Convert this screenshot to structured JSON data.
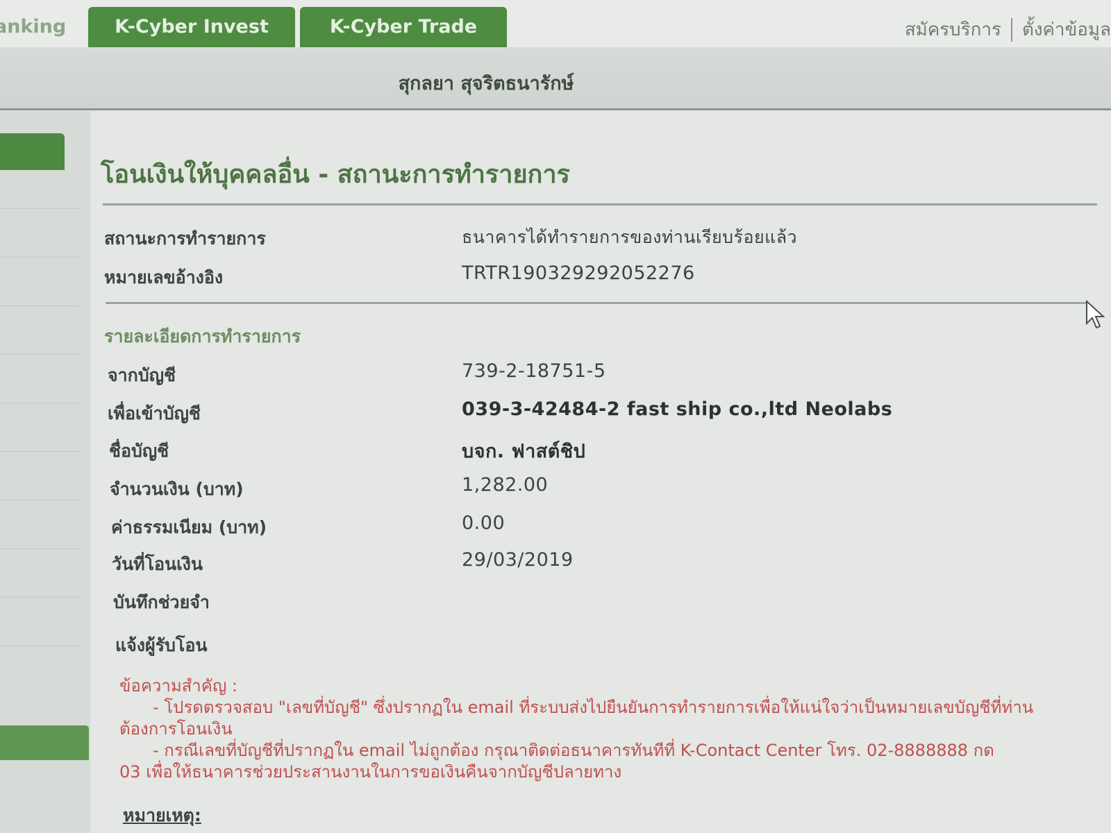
{
  "nav": {
    "partial_tab": "anking",
    "tabs": [
      {
        "label": "K-Cyber Invest"
      },
      {
        "label": "K-Cyber Trade"
      }
    ],
    "links": {
      "register": "สมัครบริการ",
      "settings": "ตั้งค่าข้อมูล"
    }
  },
  "user": {
    "name": "สุกลยา สุจริตธนารักษ์"
  },
  "page": {
    "title": "โอนเงินให้บุคคลอื่น - สถานะการทำรายการ"
  },
  "status": {
    "status_label": "สถานะการทำรายการ",
    "status_value": "ธนาคารได้ทำรายการของท่านเรียบร้อยแล้ว",
    "ref_label": "หมายเลขอ้างอิง",
    "ref_value": "TRTR190329292052276"
  },
  "details": {
    "heading": "รายละเอียดการทำรายการ",
    "from_label": "จากบัญชี",
    "from_value": "739-2-18751-5",
    "to_label": "เพื่อเข้าบัญชี",
    "to_value": "039-3-42484-2 fast ship co.,ltd Neolabs",
    "name_label": "ชื่อบัญชี",
    "name_value": "บจก. ฟาสต์ชิป",
    "amount_label": "จำนวนเงิน (บาท)",
    "amount_value": "1,282.00",
    "fee_label": "ค่าธรรมเนียม (บาท)",
    "fee_value": "0.00",
    "date_label": "วันที่โอนเงิน",
    "date_value": "29/03/2019",
    "memo_label": "บันทึกช่วยจำ",
    "notify_label": "แจ้งผู้รับโอน"
  },
  "notice": {
    "title": "ข้อความสำคัญ :",
    "line1": "- โปรดตรวจสอบ \"เลขที่บัญชี\" ซึ่งปรากฏใน email ที่ระบบส่งไปยืนยันการทำรายการเพื่อให้แน่ใจว่าเป็นหมายเลขบัญชีที่ท่าน",
    "line1b": "ต้องการโอนเงิน",
    "line2": "- กรณีเลขที่บัญชีที่ปรากฏใน email ไม่ถูกต้อง กรุณาติดต่อธนาคารทันทีที่ K-Contact Center โทร. 02-8888888 กด",
    "line2b": "03 เพื่อให้ธนาคารช่วยประสานงานในการขอเงินคืนจากบัญชีปลายทาง"
  },
  "remark": {
    "label": "หมายเหตุ:"
  }
}
